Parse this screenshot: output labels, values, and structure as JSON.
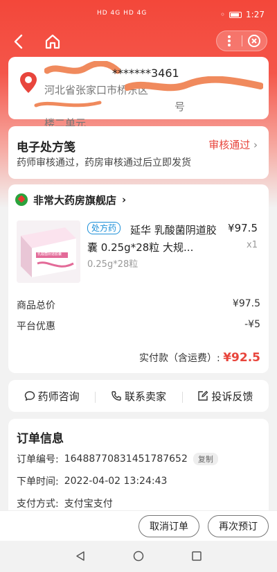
{
  "status_bar": {
    "signal": "HD 4G HD 4G",
    "time": "1:27"
  },
  "nav": {
    "back_icon": "back-arrow-icon",
    "home_icon": "home-icon",
    "more_icon": "more-icon",
    "close_icon": "close-circle-icon"
  },
  "address": {
    "name_phone": "*******3461",
    "detail": "河北省张家口市桥东区",
    "detail_end": "号",
    "detail_line2": "楼二单元"
  },
  "prescription": {
    "title": "电子处方笺",
    "status": "审核通过",
    "description": "药师审核通过，药房审核通过后立即发货"
  },
  "order": {
    "store_name": "非常大药房旗舰店",
    "product": {
      "tag": "处方药",
      "name": "延华 乳酸菌阴道胶囊 0.25g*28粒 大规...",
      "spec": "0.25g*28粒",
      "price": "¥97.5",
      "qty": "x1",
      "image_text": "乳酸菌阴道胶囊"
    },
    "subtotal_label": "商品总价",
    "subtotal_value": "¥97.5",
    "discount_label": "平台优惠",
    "discount_value": "-¥5",
    "paid_label": "实付款（含运费）:",
    "paid_value": "¥92.5"
  },
  "actions": {
    "consult": "药师咨询",
    "contact": "联系卖家",
    "complain": "投诉反馈"
  },
  "order_info": {
    "title": "订单信息",
    "order_no_label": "订单编号:",
    "order_no": "1648877083145178765​2",
    "copy_label": "复制",
    "time_label": "下单时间:",
    "time_value": "2022-04-02 13:24:43",
    "pay_label": "支付方式:",
    "pay_value": "支付宝支付"
  },
  "bottom": {
    "cancel": "取消订单",
    "reorder": "再次预订"
  },
  "colors": {
    "accent": "#e8453c",
    "header": "#f3473a",
    "rx_tag": "#1a8fd8"
  }
}
